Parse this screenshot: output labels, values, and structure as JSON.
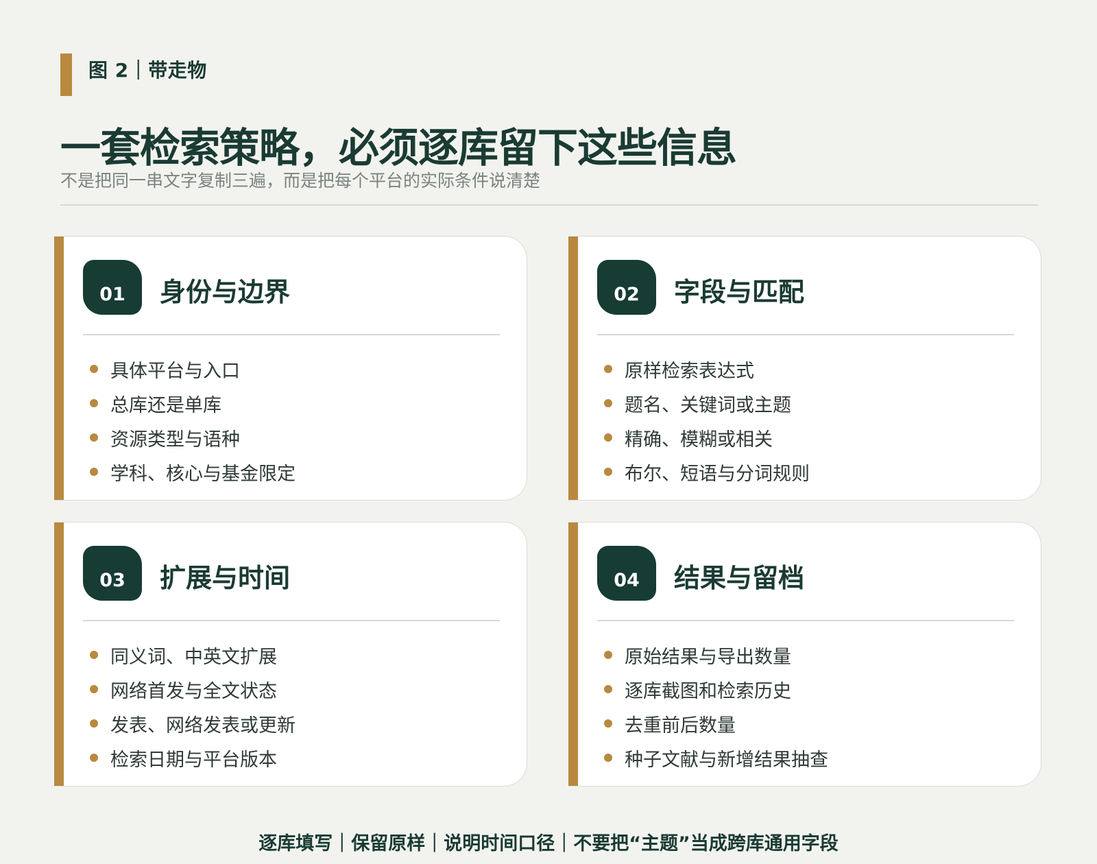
{
  "header": {
    "figure_label": "图 2｜带走物",
    "title": "一套检索策略，必须逐库留下这些信息",
    "subtitle": "不是把同一串文字复制三遍，而是把每个平台的实际条件说清楚"
  },
  "colors": {
    "accent": "#b8893f",
    "primary": "#163c34",
    "background": "#f2f3ef",
    "card": "#ffffff"
  },
  "cards": [
    {
      "number": "01",
      "title": "身份与边界",
      "items": [
        "具体平台与入口",
        "总库还是单库",
        "资源类型与语种",
        "学科、核心与基金限定"
      ]
    },
    {
      "number": "02",
      "title": "字段与匹配",
      "items": [
        "原样检索表达式",
        "题名、关键词或主题",
        "精确、模糊或相关",
        "布尔、短语与分词规则"
      ]
    },
    {
      "number": "03",
      "title": "扩展与时间",
      "items": [
        "同义词、中英文扩展",
        "网络首发与全文状态",
        "发表、网络发表或更新",
        "检索日期与平台版本"
      ]
    },
    {
      "number": "04",
      "title": "结果与留档",
      "items": [
        "原始结果与导出数量",
        "逐库截图和检索历史",
        "去重前后数量",
        "种子文献与新增结果抽查"
      ]
    }
  ],
  "footer": {
    "text": "逐库填写｜保留原样｜说明时间口径｜不要把“主题”当成跨库通用字段"
  }
}
